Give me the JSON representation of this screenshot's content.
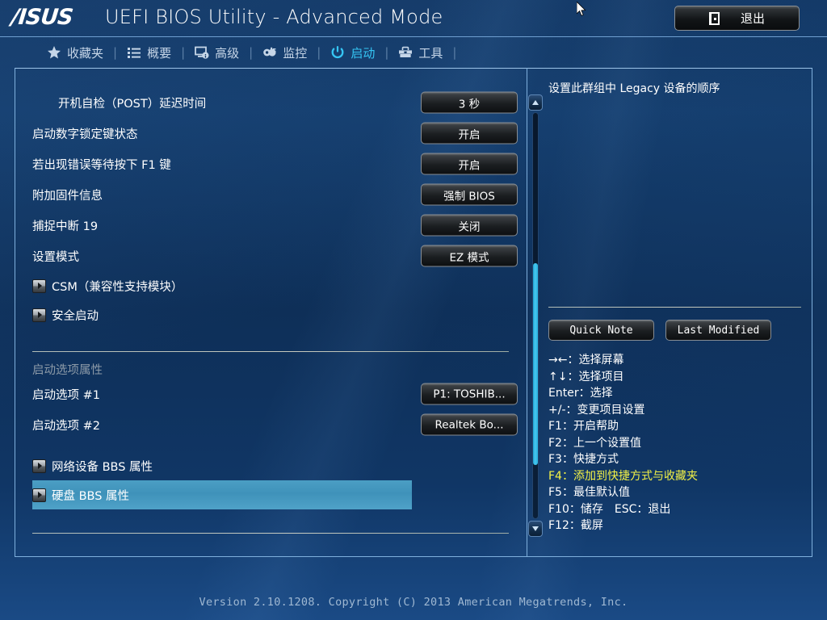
{
  "window": {
    "logo": "/ISUS",
    "title": "UEFI BIOS Utility - Advanced Mode",
    "exit_label": "退出",
    "exit_icon": "door-exit-icon"
  },
  "nav": {
    "tabs": [
      {
        "label": "收藏夹",
        "icon": "star-icon",
        "active": false
      },
      {
        "label": "概要",
        "icon": "list-icon",
        "active": false
      },
      {
        "label": "高级",
        "icon": "monitor-info-icon",
        "active": false
      },
      {
        "label": "监控",
        "icon": "thermometer-icon",
        "active": false
      },
      {
        "label": "启动",
        "icon": "power-icon",
        "active": true
      },
      {
        "label": "工具",
        "icon": "toolbox-icon",
        "active": false
      }
    ],
    "separator": "|"
  },
  "settings": {
    "rows": [
      {
        "label": "开机自检（POST）延迟时间",
        "value": "3 秒",
        "indented": true
      },
      {
        "label": "启动数字锁定键状态",
        "value": "开启",
        "indented": false
      },
      {
        "label": "若出现错误等待按下 F1 键",
        "value": "开启",
        "indented": false
      },
      {
        "label": "附加固件信息",
        "value": "强制 BIOS",
        "indented": false
      },
      {
        "label": "捕捉中断 19",
        "value": "关闭",
        "indented": false
      },
      {
        "label": "设置模式",
        "value": "EZ 模式",
        "indented": false
      }
    ],
    "submenus_top": [
      {
        "label": "CSM（兼容性支持模块）",
        "selected": false
      },
      {
        "label": "安全启动",
        "selected": false
      }
    ],
    "section_header": "启动选项属性",
    "boot_options": [
      {
        "label": "启动选项 #1",
        "value": "P1: TOSHIB..."
      },
      {
        "label": "启动选项 #2",
        "value": "Realtek Bo..."
      }
    ],
    "submenus_bottom": [
      {
        "label": "网络设备 BBS 属性",
        "selected": false
      },
      {
        "label": "硬盘 BBS 属性",
        "selected": true
      }
    ]
  },
  "help": {
    "text": "设置此群组中 Legacy 设备的顺序",
    "buttons": [
      {
        "label": "Quick Note"
      },
      {
        "label": "Last Modified"
      }
    ],
    "hotkeys": [
      {
        "text": "→←：选择屏幕",
        "accent": false
      },
      {
        "text": "↑↓：选择项目",
        "accent": false
      },
      {
        "text": "Enter：选择",
        "accent": false
      },
      {
        "text": "+/-：变更项目设置",
        "accent": false
      },
      {
        "text": "F1：开启帮助",
        "accent": false
      },
      {
        "text": "F2：上一个设置值",
        "accent": false
      },
      {
        "text": "F3：快捷方式",
        "accent": false
      },
      {
        "text": "F4：添加到快捷方式与收藏夹",
        "accent": true
      },
      {
        "text": "F5：最佳默认值",
        "accent": false
      },
      {
        "text": "F10：储存　ESC：退出",
        "accent": false
      },
      {
        "text": "F12：截屏",
        "accent": false
      }
    ]
  },
  "scrollbar": {
    "up_icon": "scroll-up-arrow-icon",
    "down_icon": "scroll-down-arrow-icon"
  },
  "footer": {
    "text": "Version 2.10.1208. Copyright (C) 2013 American Megatrends, Inc."
  },
  "colors": {
    "accent_cyan": "#35c6f4",
    "highlight_blue": "#4397bf",
    "hotkey_yellow": "#f4f246",
    "frame_border": "#7fb0dd"
  }
}
